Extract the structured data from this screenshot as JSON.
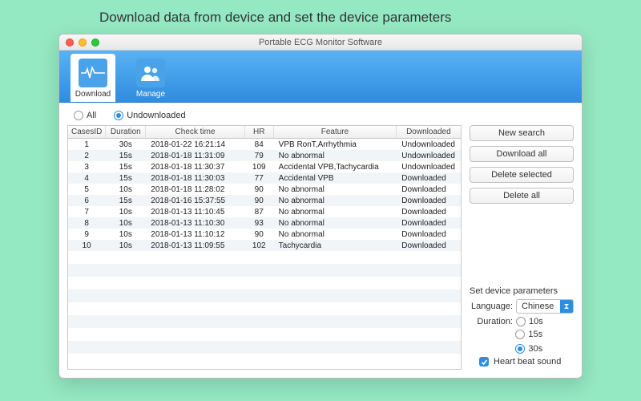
{
  "page_heading": "Download data from device and set the device parameters",
  "window_title": "Portable ECG Monitor Software",
  "tabs": {
    "download": "Download",
    "manage": "Manage"
  },
  "filter": {
    "all": "All",
    "undownloaded": "Undownloaded",
    "selected": "undownloaded"
  },
  "table": {
    "headers": {
      "id": "CasesID",
      "dur": "Duration",
      "check": "Check time",
      "hr": "HR",
      "feat": "Feature",
      "dl": "Downloaded"
    },
    "rows": [
      {
        "id": "1",
        "dur": "30s",
        "check": "2018-01-22 16:21:14",
        "hr": "84",
        "feat": "VPB RonT,Arrhythmia",
        "dl": "Undownloaded"
      },
      {
        "id": "2",
        "dur": "15s",
        "check": "2018-01-18 11:31:09",
        "hr": "79",
        "feat": "No abnormal",
        "dl": "Undownloaded"
      },
      {
        "id": "3",
        "dur": "15s",
        "check": "2018-01-18 11:30:37",
        "hr": "109",
        "feat": "Accidental VPB,Tachycardia",
        "dl": "Undownloaded"
      },
      {
        "id": "4",
        "dur": "15s",
        "check": "2018-01-18 11:30:03",
        "hr": "77",
        "feat": "Accidental VPB",
        "dl": "Downloaded"
      },
      {
        "id": "5",
        "dur": "10s",
        "check": "2018-01-18 11:28:02",
        "hr": "90",
        "feat": "No abnormal",
        "dl": "Downloaded"
      },
      {
        "id": "6",
        "dur": "15s",
        "check": "2018-01-16 15:37:55",
        "hr": "90",
        "feat": "No abnormal",
        "dl": "Downloaded"
      },
      {
        "id": "7",
        "dur": "10s",
        "check": "2018-01-13 11:10:45",
        "hr": "87",
        "feat": "No abnormal",
        "dl": "Downloaded"
      },
      {
        "id": "8",
        "dur": "10s",
        "check": "2018-01-13 11:10:30",
        "hr": "93",
        "feat": "No abnormal",
        "dl": "Downloaded"
      },
      {
        "id": "9",
        "dur": "10s",
        "check": "2018-01-13 11:10:12",
        "hr": "90",
        "feat": "No abnormal",
        "dl": "Downloaded"
      },
      {
        "id": "10",
        "dur": "10s",
        "check": "2018-01-13 11:09:55",
        "hr": "102",
        "feat": "Tachycardia",
        "dl": "Downloaded"
      }
    ]
  },
  "buttons": {
    "new_search": "New search",
    "download_all": "Download all",
    "delete_selected": "Delete selected",
    "delete_all": "Delete all"
  },
  "params": {
    "title": "Set device parameters",
    "language_label": "Language:",
    "language_value": "Chinese",
    "duration_label": "Duration:",
    "dur_10": "10s",
    "dur_15": "15s",
    "dur_30": "30s",
    "duration_selected": "30s",
    "heartbeat_label": "Heart beat sound",
    "heartbeat_checked": true
  }
}
